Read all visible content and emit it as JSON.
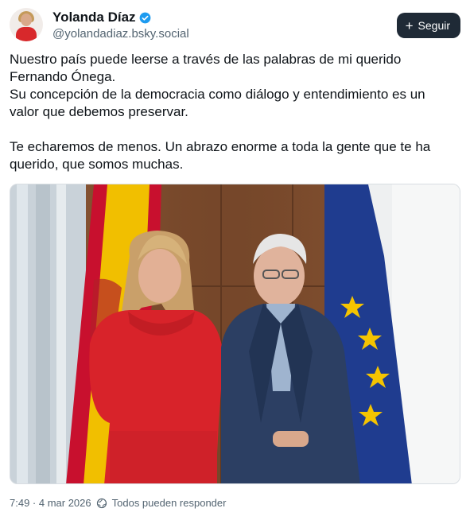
{
  "author": {
    "display_name": "Yolanda Díaz",
    "handle": "@yolandadiaz.bsky.social",
    "verified": true,
    "avatar_icon": "user-avatar"
  },
  "actions": {
    "follow_label": "Seguir",
    "follow_icon": "plus-icon"
  },
  "post": {
    "text": "Nuestro país puede leerse a través de las palabras de mi querido\nFernando Ónega.\nSu concepción de la democracia como diálogo y entendimiento es un\nvalor que debemos preservar.\n\nTe echaremos de menos. Un abrazo enorme a toda la gente que te ha\nquerido, que somos muchas.",
    "image_icon": "photo"
  },
  "footer": {
    "timestamp": "7:49 · 4 mar 2026",
    "reply_setting": "Todos pueden responder",
    "reply_icon": "globe-icon"
  },
  "colors": {
    "follow_bg": "#1f2a36",
    "verified": "#1d9bf0",
    "muted_text": "#536471"
  }
}
